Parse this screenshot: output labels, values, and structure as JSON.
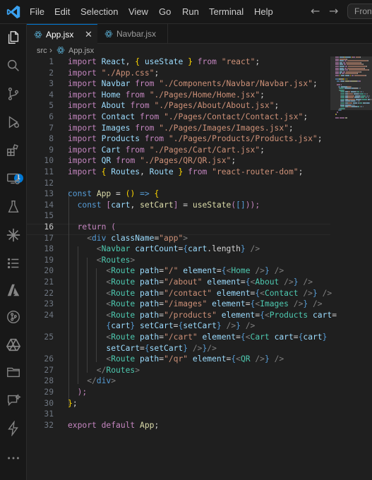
{
  "menu": [
    "File",
    "Edit",
    "Selection",
    "View",
    "Go",
    "Run",
    "Terminal",
    "Help"
  ],
  "search_text": "Front",
  "tabs": [
    {
      "label": "App.jsx",
      "active": true
    },
    {
      "label": "Navbar.jsx",
      "active": false
    }
  ],
  "breadcrumb": {
    "folder": "src",
    "file": "App.jsx"
  },
  "extensions_badge": "1",
  "current_line": 16,
  "code": {
    "l1": [
      [
        "k",
        "import"
      ],
      [
        "",
        " "
      ],
      [
        "v",
        "React"
      ],
      [
        "",
        ", "
      ],
      [
        "b",
        "{"
      ],
      [
        "",
        " "
      ],
      [
        "v",
        "useState"
      ],
      [
        "",
        " "
      ],
      [
        "b",
        "}"
      ],
      [
        "",
        " "
      ],
      [
        "k",
        "from"
      ],
      [
        "",
        " "
      ],
      [
        "s",
        "\"react\""
      ],
      [
        "",
        ";"
      ]
    ],
    "l2": [
      [
        "k",
        "import"
      ],
      [
        "",
        " "
      ],
      [
        "s",
        "\"./App.css\""
      ],
      [
        "",
        ";"
      ]
    ],
    "l3": [
      [
        "k",
        "import"
      ],
      [
        "",
        " "
      ],
      [
        "v",
        "Navbar"
      ],
      [
        "",
        " "
      ],
      [
        "k",
        "from"
      ],
      [
        "",
        " "
      ],
      [
        "s",
        "\"./Components/Navbar/Navbar.jsx\""
      ],
      [
        "",
        ";"
      ]
    ],
    "l4": [
      [
        "k",
        "import"
      ],
      [
        "",
        " "
      ],
      [
        "v",
        "Home"
      ],
      [
        "",
        " "
      ],
      [
        "k",
        "from"
      ],
      [
        "",
        " "
      ],
      [
        "s",
        "\"./Pages/Home/Home.jsx\""
      ],
      [
        "",
        ";"
      ]
    ],
    "l5": [
      [
        "k",
        "import"
      ],
      [
        "",
        " "
      ],
      [
        "v",
        "About"
      ],
      [
        "",
        " "
      ],
      [
        "k",
        "from"
      ],
      [
        "",
        " "
      ],
      [
        "s",
        "\"./Pages/About/About.jsx\""
      ],
      [
        "",
        ";"
      ]
    ],
    "l6": [
      [
        "k",
        "import"
      ],
      [
        "",
        " "
      ],
      [
        "v",
        "Contact"
      ],
      [
        "",
        " "
      ],
      [
        "k",
        "from"
      ],
      [
        "",
        " "
      ],
      [
        "s",
        "\"./Pages/Contact/Contact.jsx\""
      ],
      [
        "",
        ";"
      ]
    ],
    "l7": [
      [
        "k",
        "import"
      ],
      [
        "",
        " "
      ],
      [
        "v",
        "Images"
      ],
      [
        "",
        " "
      ],
      [
        "k",
        "from"
      ],
      [
        "",
        " "
      ],
      [
        "s",
        "\"./Pages/Images/Images.jsx\""
      ],
      [
        "",
        ";"
      ]
    ],
    "l8": [
      [
        "k",
        "import"
      ],
      [
        "",
        " "
      ],
      [
        "v",
        "Products"
      ],
      [
        "",
        " "
      ],
      [
        "k",
        "from"
      ],
      [
        "",
        " "
      ],
      [
        "s",
        "\"./Pages/Products/Products.jsx\""
      ],
      [
        "",
        ";"
      ]
    ],
    "l9": [
      [
        "k",
        "import"
      ],
      [
        "",
        " "
      ],
      [
        "v",
        "Cart"
      ],
      [
        "",
        " "
      ],
      [
        "k",
        "from"
      ],
      [
        "",
        " "
      ],
      [
        "s",
        "\"./Pages/Cart/Cart.jsx\""
      ],
      [
        "",
        ";"
      ]
    ],
    "l10": [
      [
        "k",
        "import"
      ],
      [
        "",
        " "
      ],
      [
        "v",
        "QR"
      ],
      [
        "",
        " "
      ],
      [
        "k",
        "from"
      ],
      [
        "",
        " "
      ],
      [
        "s",
        "\"./Pages/QR/QR.jsx\""
      ],
      [
        "",
        ";"
      ]
    ],
    "l11": [
      [
        "k",
        "import"
      ],
      [
        "",
        " "
      ],
      [
        "b",
        "{"
      ],
      [
        "",
        " "
      ],
      [
        "v",
        "Routes"
      ],
      [
        "",
        ", "
      ],
      [
        "v",
        "Route"
      ],
      [
        "",
        " "
      ],
      [
        "b",
        "}"
      ],
      [
        "",
        " "
      ],
      [
        "k",
        "from"
      ],
      [
        "",
        " "
      ],
      [
        "s",
        "\"react-router-dom\""
      ],
      [
        "",
        ";"
      ]
    ],
    "l12": [],
    "l13": [
      [
        "kw",
        "const"
      ],
      [
        "",
        " "
      ],
      [
        "f",
        "App"
      ],
      [
        "",
        " = "
      ],
      [
        "b",
        "()"
      ],
      [
        "",
        " "
      ],
      [
        "kw",
        "=>"
      ],
      [
        "",
        " "
      ],
      [
        "b",
        "{"
      ]
    ],
    "l14": [
      [
        "",
        ""
      ],
      [
        "kw",
        "const"
      ],
      [
        "",
        " "
      ],
      [
        "k",
        "["
      ],
      [
        "v",
        "cart"
      ],
      [
        "",
        ", "
      ],
      [
        "f",
        "setCart"
      ],
      [
        "k",
        "]"
      ],
      [
        "",
        " = "
      ],
      [
        "f",
        "useState"
      ],
      [
        "k",
        "("
      ],
      [
        "kw",
        "[]"
      ],
      [
        "k",
        "));"
      ]
    ],
    "l15": [],
    "l16": [
      [
        "k",
        "return"
      ],
      [
        "",
        " "
      ],
      [
        "k",
        "("
      ]
    ],
    "l17": [
      [
        "g",
        "<"
      ],
      [
        "kw",
        "div"
      ],
      [
        "",
        " "
      ],
      [
        "v",
        "className"
      ],
      [
        "",
        "="
      ],
      [
        "s",
        "\"app\""
      ],
      [
        "g",
        ">"
      ]
    ],
    "l18": [
      [
        "g",
        "<"
      ],
      [
        "t",
        "Navbar"
      ],
      [
        "",
        " "
      ],
      [
        "v",
        "cartCount"
      ],
      [
        "",
        "="
      ],
      [
        "kw",
        "{"
      ],
      [
        "v",
        "cart"
      ],
      [
        "",
        ".length"
      ],
      [
        "kw",
        "}"
      ],
      [
        "",
        " "
      ],
      [
        "g",
        "/>"
      ]
    ],
    "l19": [
      [
        "g",
        "<"
      ],
      [
        "t",
        "Routes"
      ],
      [
        "g",
        ">"
      ]
    ],
    "l20": [
      [
        "g",
        "<"
      ],
      [
        "t",
        "Route"
      ],
      [
        "",
        " "
      ],
      [
        "v",
        "path"
      ],
      [
        "",
        "="
      ],
      [
        "s",
        "\"/\""
      ],
      [
        "",
        " "
      ],
      [
        "v",
        "element"
      ],
      [
        "",
        "="
      ],
      [
        "kw",
        "{"
      ],
      [
        "g",
        "<"
      ],
      [
        "t",
        "Home"
      ],
      [
        "",
        " "
      ],
      [
        "g",
        "/>"
      ],
      [
        "kw",
        "}"
      ],
      [
        "",
        " "
      ],
      [
        "g",
        "/>"
      ]
    ],
    "l21": [
      [
        "g",
        "<"
      ],
      [
        "t",
        "Route"
      ],
      [
        "",
        " "
      ],
      [
        "v",
        "path"
      ],
      [
        "",
        "="
      ],
      [
        "s",
        "\"/about\""
      ],
      [
        "",
        " "
      ],
      [
        "v",
        "element"
      ],
      [
        "",
        "="
      ],
      [
        "kw",
        "{"
      ],
      [
        "g",
        "<"
      ],
      [
        "t",
        "About"
      ],
      [
        "",
        " "
      ],
      [
        "g",
        "/>"
      ],
      [
        "kw",
        "}"
      ],
      [
        "",
        " "
      ],
      [
        "g",
        "/>"
      ]
    ],
    "l22": [
      [
        "g",
        "<"
      ],
      [
        "t",
        "Route"
      ],
      [
        "",
        " "
      ],
      [
        "v",
        "path"
      ],
      [
        "",
        "="
      ],
      [
        "s",
        "\"/contact\""
      ],
      [
        "",
        " "
      ],
      [
        "v",
        "element"
      ],
      [
        "",
        "="
      ],
      [
        "kw",
        "{"
      ],
      [
        "g",
        "<"
      ],
      [
        "t",
        "Contact"
      ],
      [
        "",
        " "
      ],
      [
        "g",
        "/>"
      ],
      [
        "kw",
        "}"
      ],
      [
        "",
        " "
      ],
      [
        "g",
        "/>"
      ]
    ],
    "l23": [
      [
        "g",
        "<"
      ],
      [
        "t",
        "Route"
      ],
      [
        "",
        " "
      ],
      [
        "v",
        "path"
      ],
      [
        "",
        "="
      ],
      [
        "s",
        "\"/images\""
      ],
      [
        "",
        " "
      ],
      [
        "v",
        "element"
      ],
      [
        "",
        "="
      ],
      [
        "kw",
        "{"
      ],
      [
        "g",
        "<"
      ],
      [
        "t",
        "Images"
      ],
      [
        "",
        " "
      ],
      [
        "g",
        "/>"
      ],
      [
        "kw",
        "}"
      ],
      [
        "",
        " "
      ],
      [
        "g",
        "/>"
      ]
    ],
    "l24a": [
      [
        "g",
        "<"
      ],
      [
        "t",
        "Route"
      ],
      [
        "",
        " "
      ],
      [
        "v",
        "path"
      ],
      [
        "",
        "="
      ],
      [
        "s",
        "\"/products\""
      ],
      [
        "",
        " "
      ],
      [
        "v",
        "element"
      ],
      [
        "",
        "="
      ],
      [
        "kw",
        "{"
      ],
      [
        "g",
        "<"
      ],
      [
        "t",
        "Products"
      ],
      [
        "",
        " "
      ],
      [
        "v",
        "cart"
      ],
      [
        "",
        "="
      ]
    ],
    "l24b": [
      [
        "kw",
        "{"
      ],
      [
        "v",
        "cart"
      ],
      [
        "kw",
        "}"
      ],
      [
        "",
        " "
      ],
      [
        "v",
        "setCart"
      ],
      [
        "",
        "="
      ],
      [
        "kw",
        "{"
      ],
      [
        "v",
        "setCart"
      ],
      [
        "kw",
        "}"
      ],
      [
        "",
        " "
      ],
      [
        "g",
        "/>"
      ],
      [
        "kw",
        "}"
      ],
      [
        "",
        " "
      ],
      [
        "g",
        "/>"
      ]
    ],
    "l25a": [
      [
        "g",
        "<"
      ],
      [
        "t",
        "Route"
      ],
      [
        "",
        " "
      ],
      [
        "v",
        "path"
      ],
      [
        "",
        "="
      ],
      [
        "s",
        "\"/cart\""
      ],
      [
        "",
        " "
      ],
      [
        "v",
        "element"
      ],
      [
        "",
        "="
      ],
      [
        "kw",
        "{"
      ],
      [
        "g",
        "<"
      ],
      [
        "t",
        "Cart"
      ],
      [
        "",
        " "
      ],
      [
        "v",
        "cart"
      ],
      [
        "",
        "="
      ],
      [
        "kw",
        "{"
      ],
      [
        "v",
        "cart"
      ],
      [
        "kw",
        "}"
      ]
    ],
    "l25b": [
      [
        "v",
        "setCart"
      ],
      [
        "",
        "="
      ],
      [
        "kw",
        "{"
      ],
      [
        "v",
        "setCart"
      ],
      [
        "kw",
        "}"
      ],
      [
        "",
        " "
      ],
      [
        "g",
        "/>"
      ],
      [
        "kw",
        "}"
      ],
      [
        "g",
        "/>"
      ]
    ],
    "l26": [
      [
        "g",
        "<"
      ],
      [
        "t",
        "Route"
      ],
      [
        "",
        " "
      ],
      [
        "v",
        "path"
      ],
      [
        "",
        "="
      ],
      [
        "s",
        "\"/qr\""
      ],
      [
        "",
        " "
      ],
      [
        "v",
        "element"
      ],
      [
        "",
        "="
      ],
      [
        "kw",
        "{"
      ],
      [
        "g",
        "<"
      ],
      [
        "t",
        "QR"
      ],
      [
        "",
        " "
      ],
      [
        "g",
        "/>"
      ],
      [
        "kw",
        "}"
      ],
      [
        "",
        " "
      ],
      [
        "g",
        "/>"
      ]
    ],
    "l27": [
      [
        "g",
        "</"
      ],
      [
        "t",
        "Routes"
      ],
      [
        "g",
        ">"
      ]
    ],
    "l28": [
      [
        "g",
        "</"
      ],
      [
        "kw",
        "div"
      ],
      [
        "g",
        ">"
      ]
    ],
    "l29": [
      [
        "k",
        ");"
      ]
    ],
    "l30": [
      [
        "b",
        "}"
      ],
      [
        "",
        ";"
      ]
    ],
    "l31": [],
    "l32": [
      [
        "k",
        "export"
      ],
      [
        "",
        " "
      ],
      [
        "k",
        "default"
      ],
      [
        "",
        " "
      ],
      [
        "f",
        "App"
      ],
      [
        "",
        ";"
      ]
    ]
  },
  "colors": {
    "keyword": "#c586c0",
    "string": "#ce9178",
    "variable": "#9cdcfe",
    "function": "#dcdcaa",
    "blue": "#569cd6",
    "component": "#4ec9b0",
    "accent": "#0078d4"
  },
  "activity_icons": [
    "explorer-icon",
    "search-icon",
    "source-control-icon",
    "run-debug-icon",
    "extensions-icon",
    "remote-explorer-icon",
    "testing-icon",
    "gear-star-icon",
    "list-icon",
    "azure-icon",
    "git-graph-icon",
    "drive-icon",
    "folder-icon",
    "chat-icon",
    "lightning-icon",
    "more-icon"
  ]
}
